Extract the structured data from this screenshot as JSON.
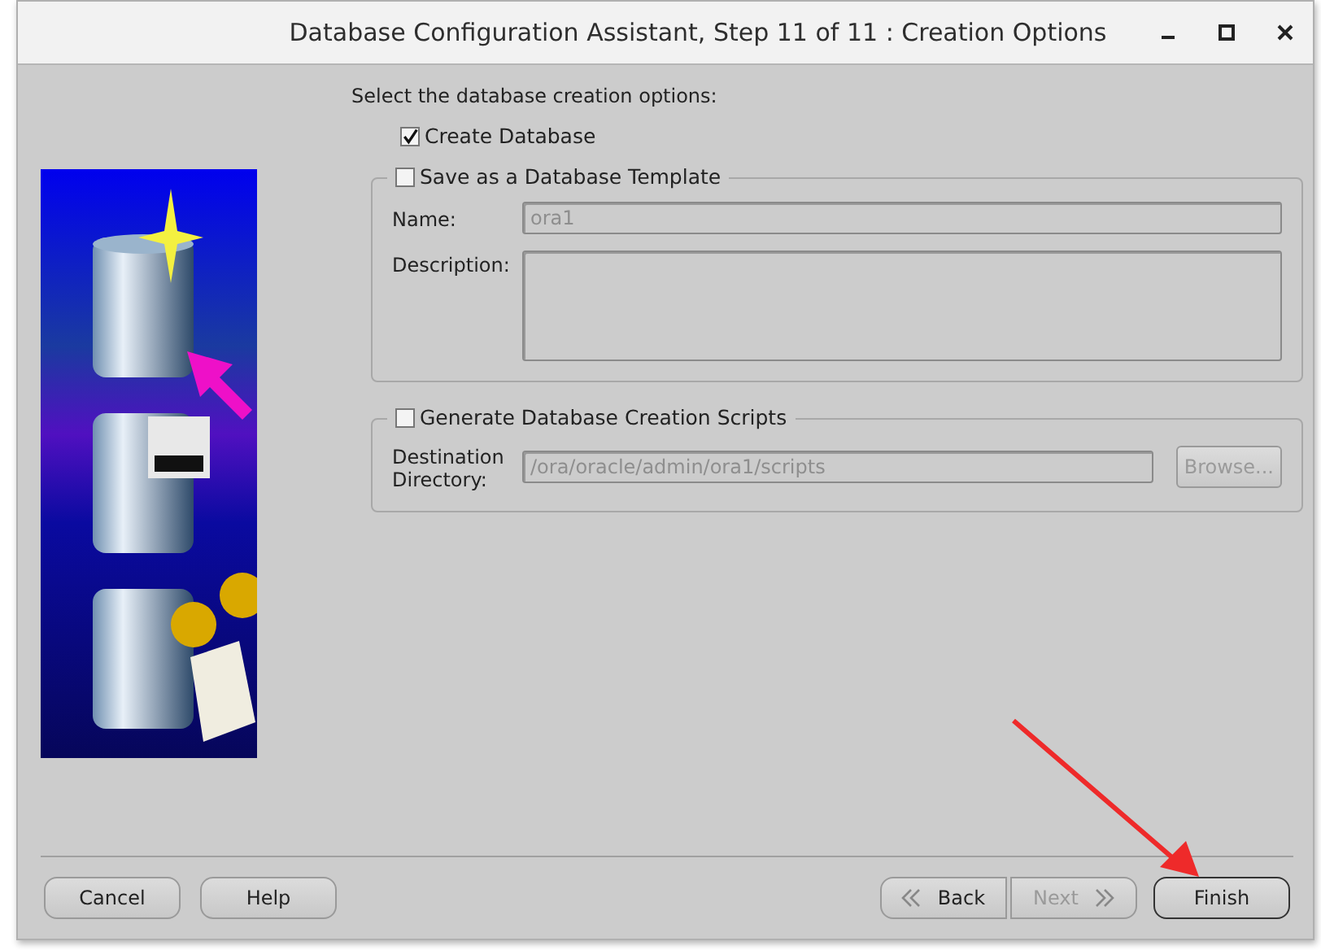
{
  "window": {
    "title": "Database Configuration Assistant, Step 11 of 11 : Creation Options"
  },
  "prompt": "Select the database creation options:",
  "options": [
    {
      "kind": "checkbox",
      "label": "Create Database",
      "checked": true
    },
    {
      "kind": "group",
      "label": "Save as a Database Template",
      "checked": false,
      "fields": [
        {
          "kind": "text",
          "label": "Name:",
          "value": "ora1",
          "disabled": true
        },
        {
          "kind": "textarea",
          "label": "Description:"
        }
      ]
    },
    {
      "kind": "group",
      "label": "Generate Database Creation Scripts",
      "checked": false,
      "fields": [
        {
          "kind": "text",
          "label": "Destination Directory:",
          "value": "/ora/oracle/admin/ora1/scripts",
          "disabled": true,
          "button": {
            "label": "Browse...",
            "disabled": true
          }
        }
      ]
    }
  ],
  "buttons_left": [
    {
      "label": "Cancel"
    },
    {
      "label": "Help"
    }
  ],
  "buttons_right": [
    {
      "label": "Back",
      "kind": "back",
      "disabled": false,
      "default": false
    },
    {
      "label": "Next",
      "kind": "next",
      "disabled": true,
      "default": false
    },
    {
      "label": "Finish",
      "disabled": false,
      "default": true
    }
  ]
}
